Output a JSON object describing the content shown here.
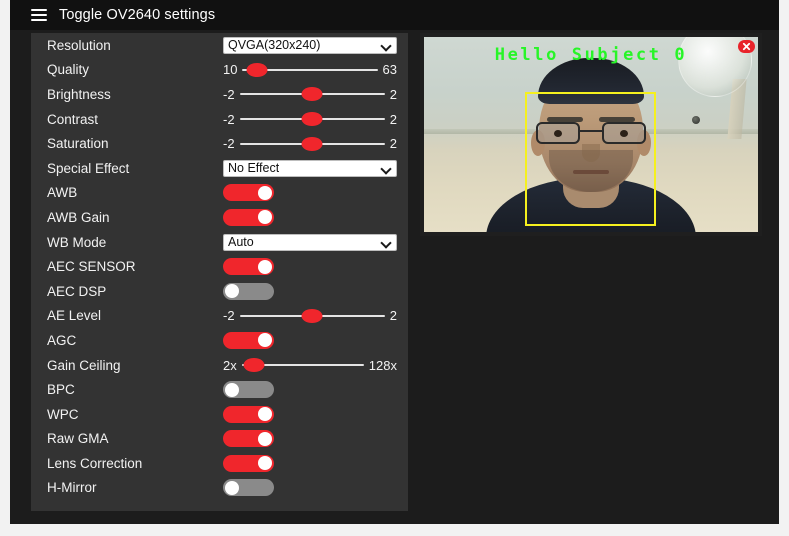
{
  "header": {
    "menu_icon": "hamburger-icon",
    "title": "Toggle OV2640 settings"
  },
  "settings": {
    "rows": [
      {
        "label": "Resolution",
        "type": "select",
        "value": "QVGA(320x240)"
      },
      {
        "label": "Quality",
        "type": "slider",
        "min": "10",
        "max": "63",
        "pos": 11
      },
      {
        "label": "Brightness",
        "type": "slider",
        "min": "-2",
        "max": "2",
        "pos": 50
      },
      {
        "label": "Contrast",
        "type": "slider",
        "min": "-2",
        "max": "2",
        "pos": 50
      },
      {
        "label": "Saturation",
        "type": "slider",
        "min": "-2",
        "max": "2",
        "pos": 50
      },
      {
        "label": "Special Effect",
        "type": "select",
        "value": "No Effect"
      },
      {
        "label": "AWB",
        "type": "toggle",
        "state": "on"
      },
      {
        "label": "AWB Gain",
        "type": "toggle",
        "state": "on"
      },
      {
        "label": "WB Mode",
        "type": "select",
        "value": "Auto"
      },
      {
        "label": "AEC SENSOR",
        "type": "toggle",
        "state": "on"
      },
      {
        "label": "AEC DSP",
        "type": "toggle",
        "state": "off"
      },
      {
        "label": "AE Level",
        "type": "slider",
        "min": "-2",
        "max": "2",
        "pos": 50
      },
      {
        "label": "AGC",
        "type": "toggle",
        "state": "on"
      },
      {
        "label": "Gain Ceiling",
        "type": "slider",
        "min": "2x",
        "max": "128x",
        "pos": 10
      },
      {
        "label": "BPC",
        "type": "toggle",
        "state": "off"
      },
      {
        "label": "WPC",
        "type": "toggle",
        "state": "on"
      },
      {
        "label": "Raw GMA",
        "type": "toggle",
        "state": "on"
      },
      {
        "label": "Lens Correction",
        "type": "toggle",
        "state": "on"
      },
      {
        "label": "H-Mirror",
        "type": "toggle",
        "state": "off"
      }
    ]
  },
  "video": {
    "greeting": "Hello Subject 0",
    "greeting_color": "#27f527",
    "face_box_color": "#f5f01e",
    "close_label": "x",
    "close_color": "#e8232a"
  },
  "colors": {
    "accent": "#f0262c",
    "panel_bg": "#333333",
    "page_bg": "#1c1c1c",
    "header_bg": "#111111",
    "text": "#f2f2f2"
  }
}
